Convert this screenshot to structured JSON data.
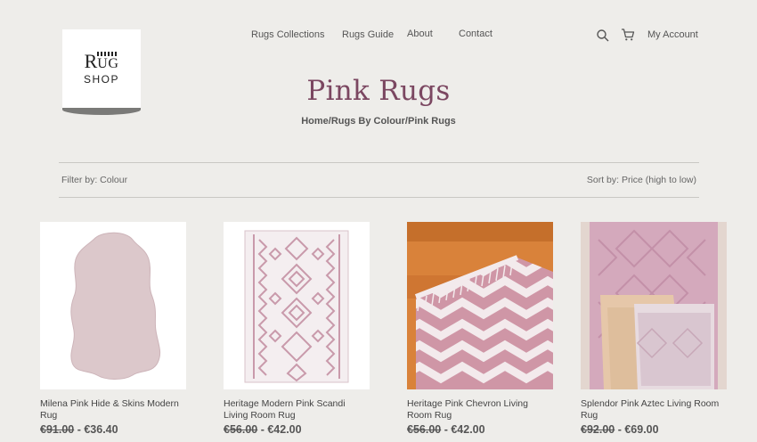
{
  "logo": {
    "line1": "R",
    "line1b": "UG",
    "line2": "SHOP"
  },
  "nav": {
    "items": [
      "Rugs Collections",
      "Rugs Guide",
      "About",
      "Contact"
    ],
    "account": "My Account",
    "search_icon": "search-icon",
    "cart_icon": "cart-icon"
  },
  "page": {
    "title": "Pink Rugs",
    "breadcrumb": "Home/Rugs By Colour/Pink Rugs"
  },
  "toolbar": {
    "filter": "Filter by: Colour",
    "sort": "Sort by: Price (high to low)"
  },
  "products": [
    {
      "name": "Milena Pink Hide & Skins Modern Rug",
      "old_price": "€91.00",
      "sep": " - ",
      "price": "€36.40"
    },
    {
      "name": "Heritage Modern Pink Scandi Living Room Rug",
      "old_price": "€56.00",
      "sep": " - ",
      "price": "€42.00"
    },
    {
      "name": "Heritage Pink Chevron Living Room Rug",
      "old_price": "€56.00",
      "sep": " - ",
      "price": "€42.00"
    },
    {
      "name": "Splendor Pink Aztec Living Room Rug",
      "old_price": "€92.00",
      "sep": " - ",
      "price": "€69.00"
    }
  ],
  "colors": {
    "background": "#eeedea",
    "title": "#7b4761",
    "rug_pink": "#d8b8c2"
  }
}
